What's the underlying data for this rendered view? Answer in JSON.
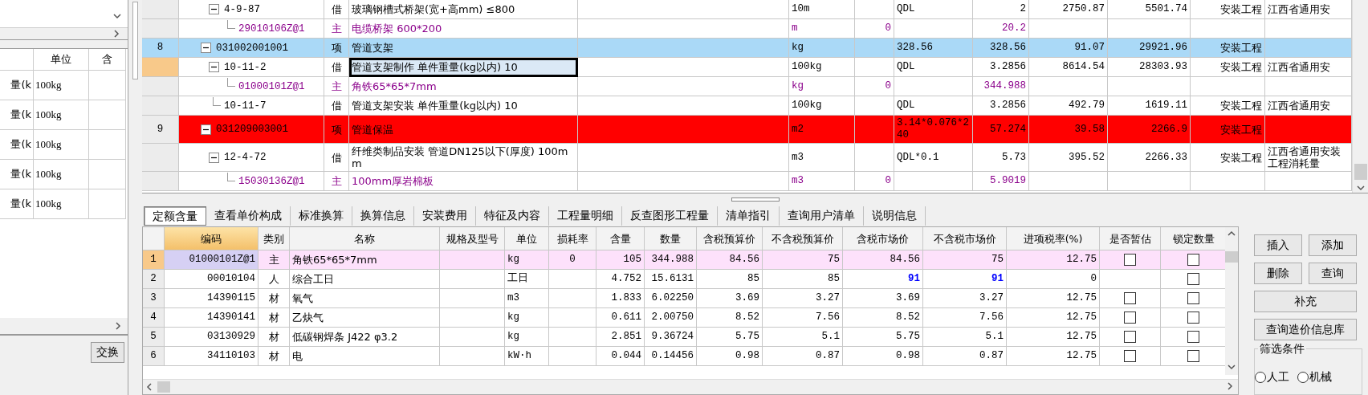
{
  "left_panel": {
    "columns": [
      {
        "label": "单位"
      },
      {
        "label": "含"
      }
    ],
    "rows": [
      {
        "name": "量(k",
        "unit": "100kg"
      },
      {
        "name": "量(k",
        "unit": "100kg"
      },
      {
        "name": "量(k",
        "unit": "100kg"
      },
      {
        "name": "量(k",
        "unit": "100kg"
      },
      {
        "name": "量(k",
        "unit": "100kg"
      }
    ],
    "button": "交换"
  },
  "top_table": {
    "rows": [
      {
        "kind": "quota",
        "code": "4-9-87",
        "type": "借",
        "name": "玻璃钢槽式桥架(宽+高mm) ≤800",
        "unit": "10m",
        "expr": "QDL",
        "qty": "2",
        "price": "2750.87",
        "total": "5501.74",
        "category": "安装工程",
        "library": "江西省通用安",
        "selected": false,
        "current": false,
        "expanded": true,
        "children": [
          {
            "kind": "material",
            "code": "29010106Z@1",
            "type": "主",
            "name": "电缆桥架 600*200",
            "unit": "m",
            "loss": "0",
            "qty": "20.2",
            "selected": false,
            "current": false
          }
        ]
      },
      {
        "kind": "item",
        "row_no": "8",
        "code": "031002001001",
        "type": "项",
        "name": "管道支架",
        "unit": "kg",
        "expr": "328.56",
        "qty": "328.56",
        "price": "91.07",
        "total": "29921.96",
        "category": "安装工程",
        "selected": true,
        "current": false,
        "expanded": true,
        "children": [
          {
            "kind": "quota",
            "code": "10-11-2",
            "type": "借",
            "name": "管道支架制作 单件重量(kg以内) 10",
            "unit": "100kg",
            "expr": "QDL",
            "qty": "3.2856",
            "price": "8614.54",
            "total": "28303.93",
            "category": "安装工程",
            "library": "江西省通用安",
            "selected": false,
            "current": true,
            "expanded": true,
            "children": [
              {
                "kind": "material",
                "code": "01000101Z@1",
                "type": "主",
                "name": "角铁65*65*7mm",
                "unit": "kg",
                "loss": "0",
                "qty": "344.988",
                "selected": false,
                "current": false
              }
            ]
          },
          {
            "kind": "quota",
            "code": "10-11-7",
            "type": "借",
            "name": "管道支架安装 单件重量(kg以内) 10",
            "unit": "100kg",
            "expr": "QDL",
            "qty": "3.2856",
            "price": "492.79",
            "total": "1619.11",
            "category": "安装工程",
            "library": "江西省通用安",
            "selected": false,
            "current": false
          }
        ]
      },
      {
        "kind": "item",
        "row_no": "9",
        "code": "031209003001",
        "type": "项",
        "name": "管道保温",
        "unit": "m2",
        "expr": "3.14*0.076*240",
        "qty": "57.274",
        "price": "39.58",
        "total": "2266.9",
        "category": "安装工程",
        "selected": false,
        "current": false,
        "color": "#ff0000",
        "expanded": true,
        "children": [
          {
            "kind": "quota",
            "code": "12-4-72",
            "type": "借",
            "name": "纤维类制品安装 管道DN125以下(厚度) 100mm",
            "unit": "m3",
            "expr": "QDL*0.1",
            "qty": "5.73",
            "price": "395.52",
            "total": "2266.33",
            "category": "安装工程",
            "library": "江西省通用安装工程消耗量",
            "selected": false,
            "current": false,
            "expanded": true,
            "children": [
              {
                "kind": "material",
                "code": "15030136Z@1",
                "type": "主",
                "name": "100mm厚岩棉板",
                "unit": "m3",
                "loss": "0",
                "qty": "5.9019",
                "selected": false,
                "current": false
              }
            ]
          }
        ]
      }
    ]
  },
  "tabs": [
    {
      "label": "定额含量",
      "selected": true
    },
    {
      "label": "查看单价构成",
      "selected": false
    },
    {
      "label": "标准换算",
      "selected": false
    },
    {
      "label": "换算信息",
      "selected": false
    },
    {
      "label": "安装费用",
      "selected": false
    },
    {
      "label": "特征及内容",
      "selected": false
    },
    {
      "label": "工程量明细",
      "selected": false
    },
    {
      "label": "反查图形工程量",
      "selected": false
    },
    {
      "label": "清单指引",
      "selected": false
    },
    {
      "label": "查询用户清单",
      "selected": false
    },
    {
      "label": "说明信息",
      "selected": false
    }
  ],
  "bottom_table": {
    "columns": [
      {
        "label": "编码",
        "current": true
      },
      {
        "label": "类别",
        "current": false
      },
      {
        "label": "名称",
        "current": false
      },
      {
        "label": "规格及型号",
        "current": false
      },
      {
        "label": "单位",
        "current": false
      },
      {
        "label": "损耗率",
        "current": false
      },
      {
        "label": "含量",
        "current": false
      },
      {
        "label": "数量",
        "current": false
      },
      {
        "label": "含税预算价",
        "current": false
      },
      {
        "label": "不含税预算价",
        "current": false
      },
      {
        "label": "含税市场价",
        "current": false
      },
      {
        "label": "不含税市场价",
        "current": false
      },
      {
        "label": "进项税率(%)",
        "current": false
      },
      {
        "label": "是否暂估",
        "current": false
      },
      {
        "label": "锁定数量",
        "current": false
      }
    ],
    "rows": [
      {
        "no": "1",
        "code": "01000101Z@1",
        "type": "主",
        "name": "角铁65*65*7mm",
        "unit": "kg",
        "loss": "0",
        "content": "105",
        "qty": "344.988",
        "tax_budget": "84.56",
        "budget": "75",
        "tax_market": "84.56",
        "market": "75",
        "rate": "12.75",
        "estimate": false,
        "locked": false,
        "selected": true,
        "market_changed": false
      },
      {
        "no": "2",
        "code": "00010104",
        "type": "人",
        "name": "综合工日",
        "unit": "工日",
        "content": "4.752",
        "qty": "15.6131",
        "tax_budget": "85",
        "budget": "85",
        "tax_market": "91",
        "market": "91",
        "rate": "0",
        "locked": false,
        "selected": false,
        "market_changed": true
      },
      {
        "no": "3",
        "code": "14390115",
        "type": "材",
        "name": "氧气",
        "unit": "m3",
        "content": "1.833",
        "qty": "6.02250",
        "tax_budget": "3.69",
        "budget": "3.27",
        "tax_market": "3.69",
        "market": "3.27",
        "rate": "12.75",
        "estimate": false,
        "locked": false,
        "selected": false,
        "market_changed": false
      },
      {
        "no": "4",
        "code": "14390141",
        "type": "材",
        "name": "乙炔气",
        "unit": "kg",
        "content": "0.611",
        "qty": "2.00750",
        "tax_budget": "8.52",
        "budget": "7.56",
        "tax_market": "8.52",
        "market": "7.56",
        "rate": "12.75",
        "estimate": false,
        "locked": false,
        "selected": false,
        "market_changed": false
      },
      {
        "no": "5",
        "code": "03130929",
        "type": "材",
        "name": "低碳钢焊条 J422 φ3.2",
        "unit": "kg",
        "content": "2.851",
        "qty": "9.36724",
        "tax_budget": "5.75",
        "budget": "5.1",
        "tax_market": "5.75",
        "market": "5.1",
        "rate": "12.75",
        "estimate": false,
        "locked": false,
        "selected": false,
        "market_changed": false
      },
      {
        "no": "6",
        "code": "34110103",
        "type": "材",
        "name": "电",
        "unit": "kW·h",
        "content": "0.044",
        "qty": "0.14456",
        "tax_budget": "0.98",
        "budget": "0.87",
        "tax_market": "0.98",
        "market": "0.87",
        "rate": "12.75",
        "estimate": false,
        "locked": false,
        "selected": false,
        "market_changed": false
      }
    ]
  },
  "side_buttons": [
    {
      "label": "插入",
      "kind": "half"
    },
    {
      "label": "添加",
      "kind": "half"
    },
    {
      "label": "删除",
      "kind": "half"
    },
    {
      "label": "查询",
      "kind": "half"
    },
    {
      "label": "补充",
      "kind": "full"
    },
    {
      "label": "查询造价信息库",
      "kind": "full"
    }
  ],
  "filter": {
    "title": "筛选条件",
    "options": [
      {
        "label": "人工",
        "selected": false
      },
      {
        "label": "机械",
        "selected": false
      }
    ]
  }
}
